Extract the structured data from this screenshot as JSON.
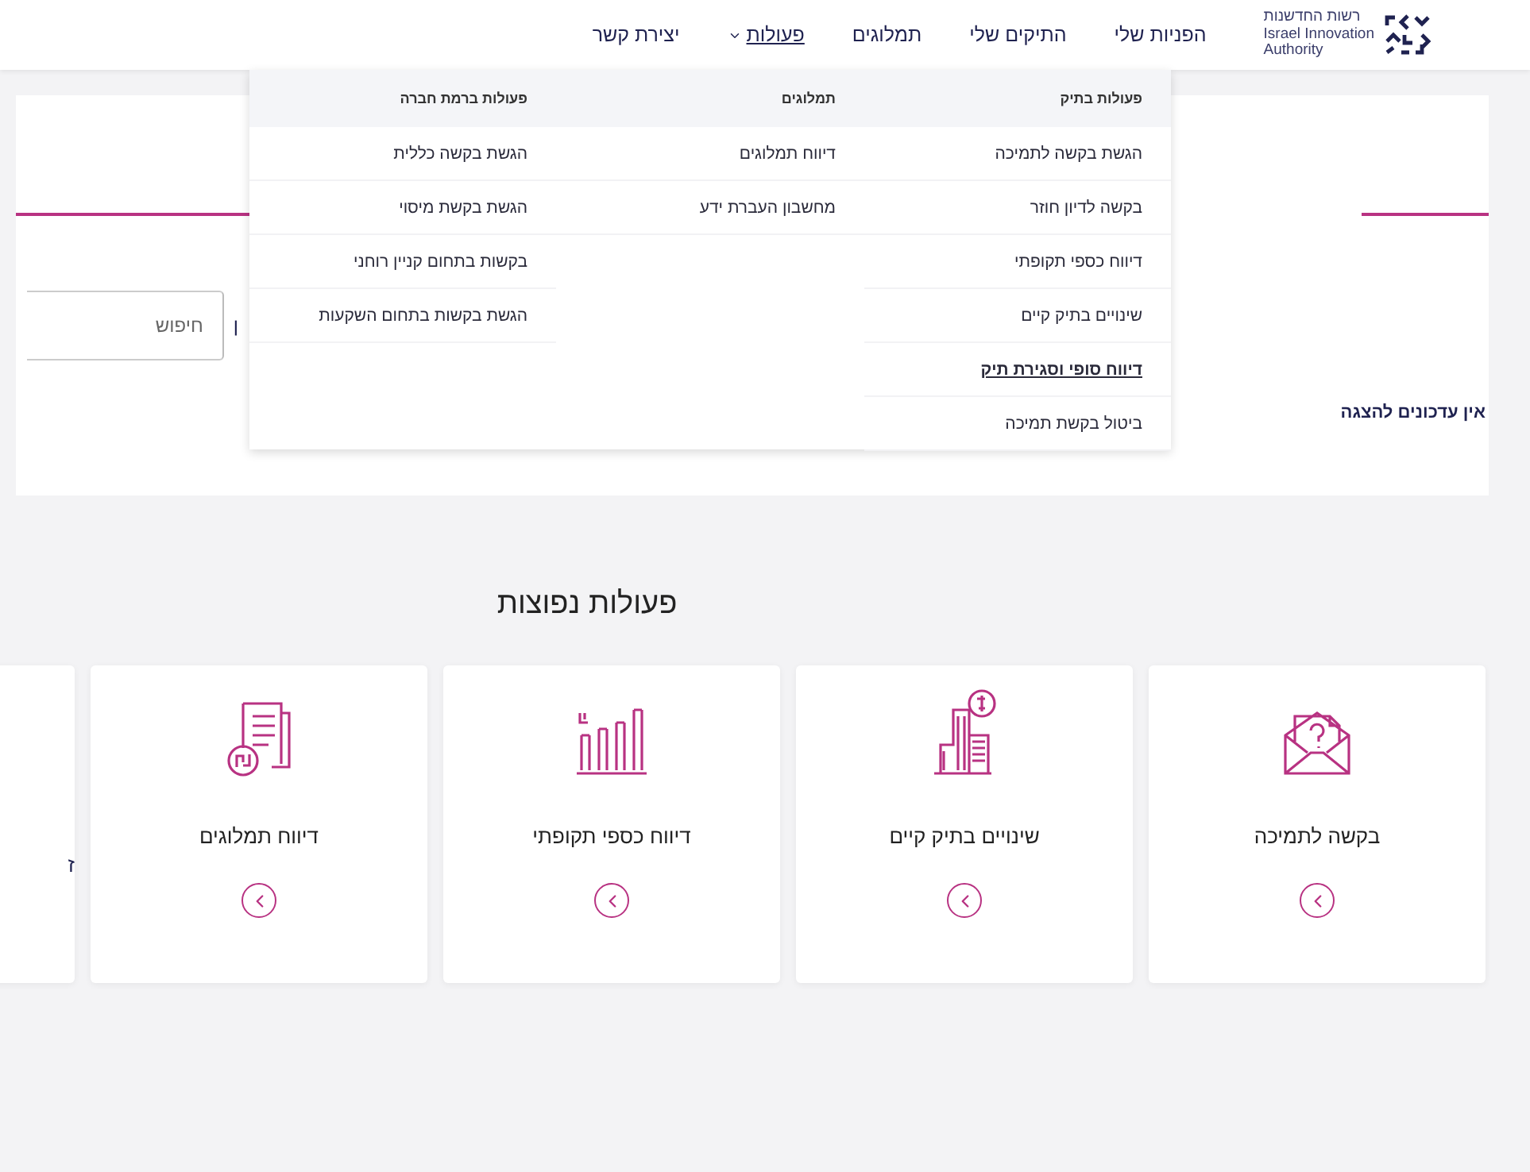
{
  "header": {
    "logo": {
      "lines": [
        "רשות החדשנות",
        "Israel Innovation",
        "Authority"
      ]
    },
    "nav": [
      {
        "label": "הפניות שלי",
        "selected": false,
        "has_menu": false
      },
      {
        "label": "התיקים שלי",
        "selected": false,
        "has_menu": false
      },
      {
        "label": "תמלוגים",
        "selected": false,
        "has_menu": false
      },
      {
        "label": "פעולות",
        "selected": true,
        "has_menu": true
      },
      {
        "label": "יצירת קשר",
        "selected": false,
        "has_menu": false
      }
    ]
  },
  "dropdown": {
    "columns": [
      {
        "heading": "פעולות בתיק",
        "items": [
          {
            "label": "הגשת בקשה לתמיכה",
            "selected": false
          },
          {
            "label": "בקשה לדיון חוזר",
            "selected": false
          },
          {
            "label": "דיווח כספי תקופתי",
            "selected": false
          },
          {
            "label": "שינויים בתיק קיים",
            "selected": false
          },
          {
            "label": "דיווח סופי וסגירת תיק",
            "selected": true
          },
          {
            "label": "ביטול בקשת תמיכה",
            "selected": false
          }
        ]
      },
      {
        "heading": "תמלוגים",
        "items": [
          {
            "label": "דיווח תמלוגים",
            "selected": false
          },
          {
            "label": "מחשבון העברת ידע",
            "selected": false
          }
        ]
      },
      {
        "heading": "פעולות ברמת חברה",
        "items": [
          {
            "label": "הגשת בקשה כללית",
            "selected": false
          },
          {
            "label": "הגשת בקשת מיסוי",
            "selected": false
          },
          {
            "label": "בקשות בתחום קניין רוחני",
            "selected": false
          },
          {
            "label": "הגשת בקשות בתחום השקעות",
            "selected": false
          }
        ]
      }
    ]
  },
  "updates_panel": {
    "empty_message": "אין עדכונים להצגה",
    "covered_text": "ן",
    "search": {
      "placeholder": "חיפוש"
    }
  },
  "common_actions": {
    "title": "פעולות נפוצות",
    "cards": [
      {
        "kind": "envelope",
        "title": "בקשה לתמיכה"
      },
      {
        "kind": "buildings",
        "title": "שינויים בתיק קיים"
      },
      {
        "kind": "chart",
        "title": "דיווח כספי תקופתי"
      },
      {
        "kind": "document",
        "title": "דיווח תמלוגים"
      },
      {
        "kind": "cut",
        "title": "ז"
      }
    ]
  }
}
